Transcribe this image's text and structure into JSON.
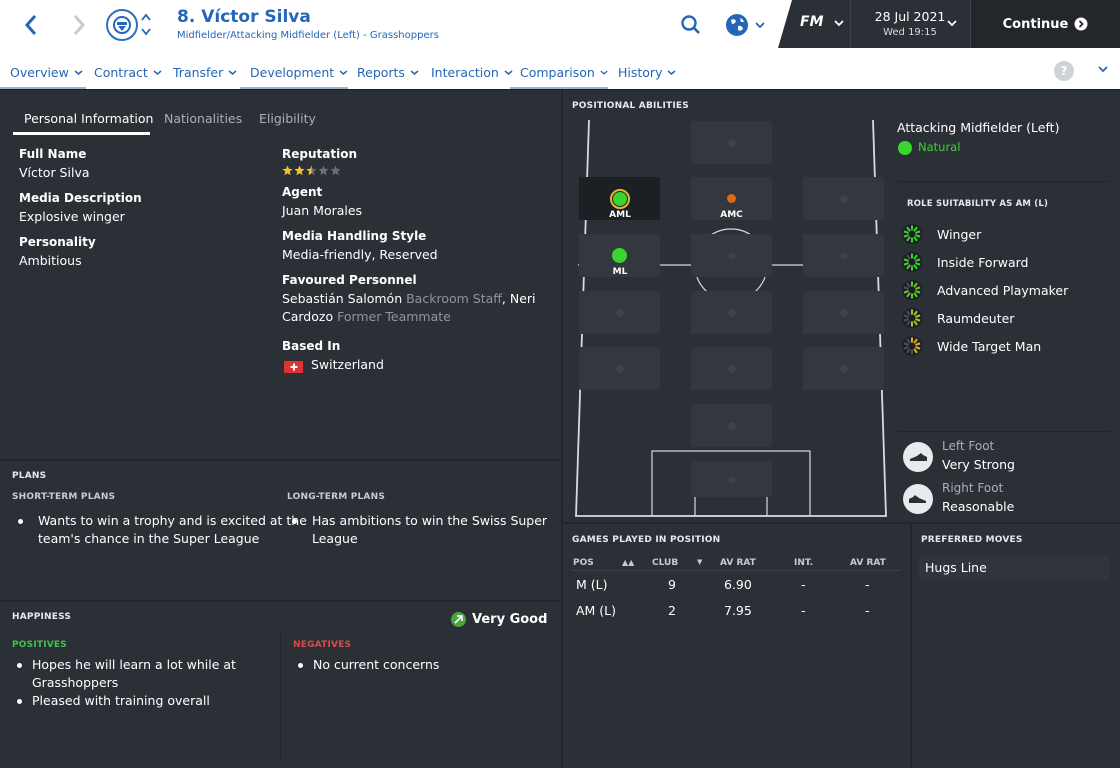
{
  "header": {
    "player_name": "8. Víctor Silva",
    "player_subtitle": "Midfielder/Attacking Midfielder (Left) - Grasshoppers",
    "fm_logo": "FM",
    "date": "28 Jul 2021",
    "day_time": "Wed 19:15",
    "continue_label": "Continue",
    "help_label": "?"
  },
  "nav_tabs": [
    "Overview",
    "Contract",
    "Transfer",
    "Development",
    "Reports",
    "Interaction",
    "Comparison",
    "History"
  ],
  "sub_tabs": [
    "Personal Information",
    "Nationalities",
    "Eligibility"
  ],
  "personal": {
    "full_name_label": "Full Name",
    "full_name": "Víctor Silva",
    "media_desc_label": "Media Description",
    "media_desc": "Explosive winger",
    "personality_label": "Personality",
    "personality": "Ambitious",
    "reputation_label": "Reputation",
    "reputation_stars": 2.5,
    "agent_label": "Agent",
    "agent": "Juan Morales",
    "media_style_label": "Media Handling Style",
    "media_style": "Media-friendly, Reserved",
    "fav_personnel_label": "Favoured Personnel",
    "fav1_name": "Sebastián Salomón",
    "fav1_role": "Backroom Staff",
    "fav_comma": ",",
    "fav2_name_a": "Neri",
    "fav2_name_b": "Cardozo",
    "fav2_role": "Former Teammate",
    "based_in_label": "Based In",
    "based_in": "Switzerland"
  },
  "plans": {
    "title": "PLANS",
    "short_title": "SHORT-TERM PLANS",
    "short_line1": "Wants to win a trophy and is excited at the",
    "short_line2": "team's chance in the Super League",
    "long_title": "LONG-TERM PLANS",
    "long_line1": "Has ambitions to win the Swiss Super",
    "long_line2": "League"
  },
  "happiness": {
    "title": "HAPPINESS",
    "status": "Very Good",
    "positives_title": "POSITIVES",
    "pos1_line1": "Hopes he will learn a lot while at",
    "pos1_line2": "Grasshoppers",
    "pos2": "Pleased with training overall",
    "negatives_title": "NEGATIVES",
    "neg1": "No current concerns"
  },
  "positional": {
    "title": "POSITIONAL ABILITIES",
    "selected_position": "Attacking Midfielder (Left)",
    "selected_rating": "Natural",
    "aml_label": "AML",
    "amc_label": "AMC",
    "ml_label": "ML",
    "role_title": "ROLE SUITABILITY AS AM (L)",
    "roles": [
      "Winger",
      "Inside Forward",
      "Advanced Playmaker",
      "Raumdeuter",
      "Wide Target Man"
    ],
    "left_foot_label": "Left Foot",
    "left_foot": "Very Strong",
    "right_foot_label": "Right Foot",
    "right_foot": "Reasonable"
  },
  "games": {
    "title": "GAMES PLAYED IN POSITION",
    "headers": [
      "POS",
      "CLUB",
      "AV RAT",
      "INT.",
      "AV RAT"
    ],
    "rows": [
      {
        "pos": "M (L)",
        "club": "9",
        "av_rat": "6.90",
        "int": "-",
        "int_av_rat": "-"
      },
      {
        "pos": "AM (L)",
        "club": "2",
        "av_rat": "7.95",
        "int": "-",
        "int_av_rat": "-"
      }
    ]
  },
  "preferred_moves": {
    "title": "PREFERRED MOVES",
    "moves": [
      "Hugs Line"
    ]
  },
  "colors": {
    "accent_blue": "#2566b8",
    "natural_green": "#39d42f",
    "amc_orange": "#e06a10",
    "positives_green": "#3ec34a",
    "negatives_red": "#e04848"
  }
}
